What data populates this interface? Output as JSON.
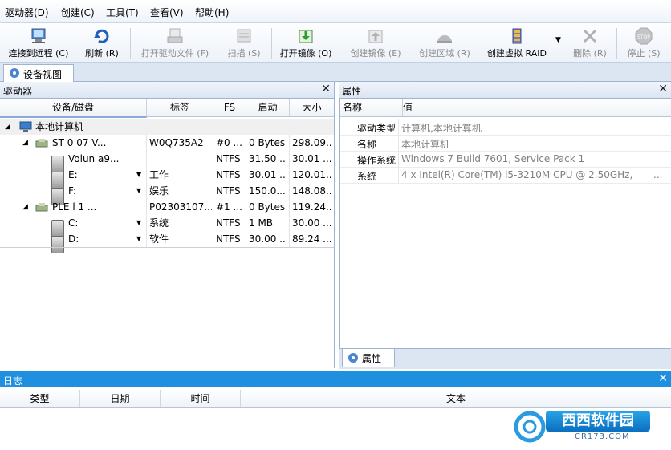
{
  "menu": [
    "驱动器(D)",
    "创建(C)",
    "工具(T)",
    "查看(V)",
    "帮助(H)"
  ],
  "toolbar": {
    "connect": "连接到远程 (C)",
    "refresh": "刷新 (R)",
    "open_drive_file": "打开驱动文件 (F)",
    "scan": "扫描 (S)",
    "open_image": "打开镜像 (O)",
    "create_image": "创建镜像 (E)",
    "create_region": "创建区域 (R)",
    "create_raid": "创建虚拟 RAID",
    "delete": "删除 (R)",
    "stop": "停止 (S)"
  },
  "tabs": {
    "device_view": "设备视图",
    "properties": "属性"
  },
  "drives_pane": {
    "title": "驱动器",
    "columns": [
      "设备/磁盘",
      "标签",
      "FS",
      "启动",
      "大小"
    ],
    "rows": [
      {
        "name": "本地计算机",
        "label": "",
        "fs": "",
        "start": "",
        "size": ""
      },
      {
        "name": "ST    0     07    V...",
        "label": "W0Q735A2",
        "fs": "#0 ...",
        "start": "0 Bytes",
        "size": "298.09..."
      },
      {
        "name": "Volun          a9...",
        "label": "",
        "fs": "NTFS",
        "start": "31.50 ...",
        "size": "30.01 ..."
      },
      {
        "name": "E:",
        "label": "工作",
        "fs": "NTFS",
        "start": "30.01 ...",
        "size": "120.01..."
      },
      {
        "name": "F:",
        "label": "娱乐",
        "fs": "NTFS",
        "start": "150.0...",
        "size": "148.08..."
      },
      {
        "name": "PLE      l    1     ...",
        "label": "P02303107...",
        "fs": "#1 ...",
        "start": "0 Bytes",
        "size": "119.24..."
      },
      {
        "name": "C:",
        "label": "系统",
        "fs": "NTFS",
        "start": "1 MB",
        "size": "30.00 ..."
      },
      {
        "name": "D:",
        "label": "软件",
        "fs": "NTFS",
        "start": "30.00 ...",
        "size": "89.24 ..."
      }
    ]
  },
  "props_pane": {
    "title": "属性",
    "columns": [
      "名称",
      "值"
    ],
    "rows": [
      {
        "k": "驱动类型",
        "v": "计算机,本地计算机"
      },
      {
        "k": "名称",
        "v": "本地计算机"
      },
      {
        "k": "操作系统",
        "v": "Windows 7 Build 7601, Service Pack 1"
      },
      {
        "k": "系统",
        "v": "4 x Intel(R) Core(TM) i5-3210M CPU @ 2.50GHz,"
      }
    ],
    "ellipsis": "..."
  },
  "log_pane": {
    "title": "日志",
    "columns": [
      "类型",
      "日期",
      "时间",
      "文本"
    ]
  },
  "watermark": {
    "brand": "西西软件园",
    "domain": "CR173.COM"
  }
}
